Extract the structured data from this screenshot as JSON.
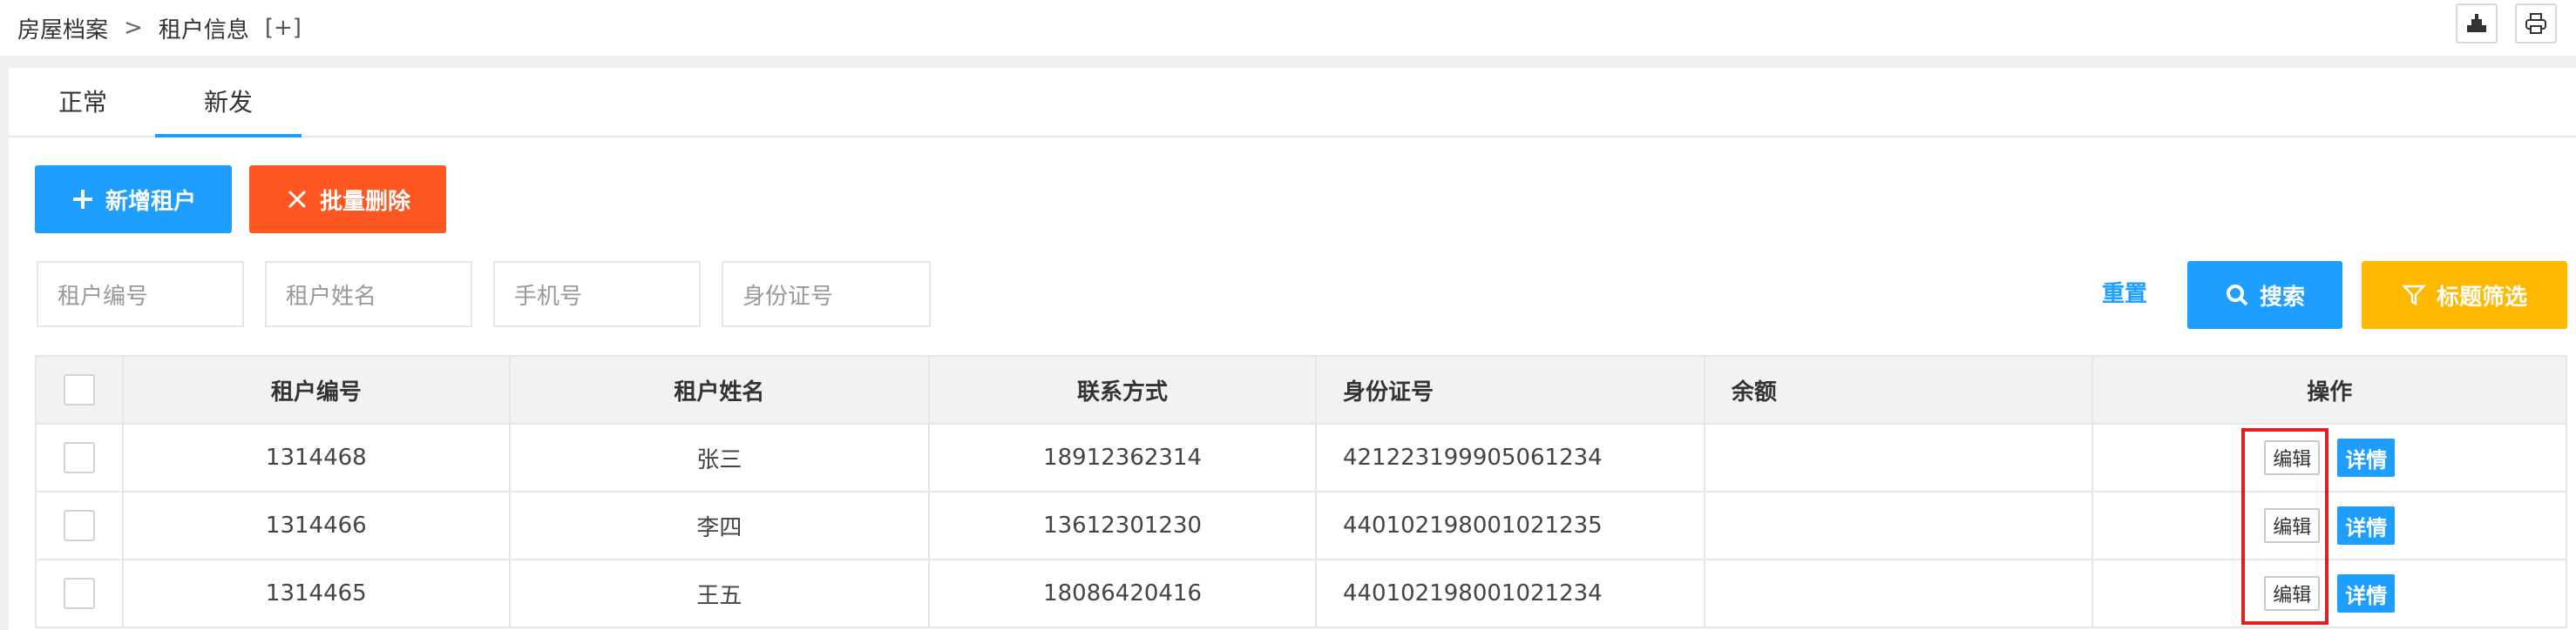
{
  "breadcrumb": {
    "root": "房屋档案",
    "separator": ">",
    "current": "租户信息",
    "expand": "[+]"
  },
  "toolbar_icons": [
    "export-icon",
    "print-icon"
  ],
  "tabs": [
    {
      "label": "正常",
      "active": false
    },
    {
      "label": "新发",
      "active": true
    }
  ],
  "actions": {
    "add_label": "新增租户",
    "batch_delete_label": "批量删除"
  },
  "filters": {
    "tenant_no_placeholder": "租户编号",
    "tenant_name_placeholder": "租户姓名",
    "phone_placeholder": "手机号",
    "id_card_placeholder": "身份证号",
    "reset_label": "重置",
    "search_label": "搜索",
    "column_filter_label": "标题筛选"
  },
  "table": {
    "headers": [
      "租户编号",
      "租户姓名",
      "联系方式",
      "身份证号",
      "余额",
      "操作"
    ],
    "rows": [
      {
        "tenant_no": "1314468",
        "name": "张三",
        "phone": "18912362314",
        "id_card": "421223199905061234",
        "balance": "",
        "edit": "编辑",
        "detail": "详情"
      },
      {
        "tenant_no": "1314466",
        "name": "李四",
        "phone": "13612301230",
        "id_card": "440102198001021235",
        "balance": "",
        "edit": "编辑",
        "detail": "详情"
      },
      {
        "tenant_no": "1314465",
        "name": "王五",
        "phone": "18086420416",
        "id_card": "440102198001021234",
        "balance": "",
        "edit": "编辑",
        "detail": "详情"
      }
    ]
  },
  "colors": {
    "primary": "#1e9fff",
    "danger": "#ff5722",
    "warning": "#ffb800",
    "highlight": "#e02020"
  }
}
